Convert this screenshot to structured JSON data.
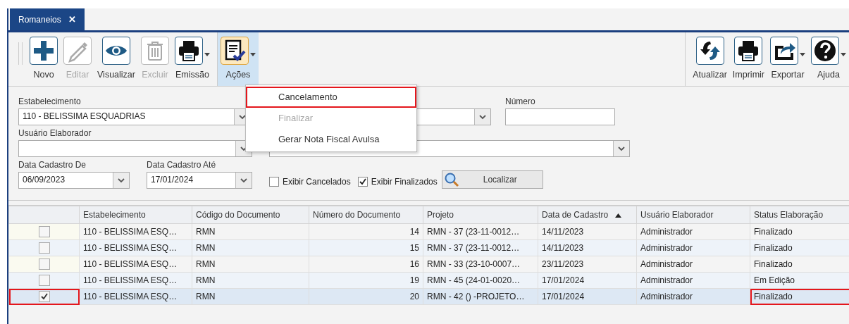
{
  "tabs": [
    {
      "label": "Romaneios",
      "selected": true,
      "close": "✕"
    }
  ],
  "toolbar": {
    "left": [
      {
        "label": "Novo",
        "disabled": false,
        "dropdown": false,
        "active": false
      },
      {
        "label": "Editar",
        "disabled": true,
        "dropdown": false,
        "active": false
      },
      {
        "label": "Visualizar",
        "disabled": false,
        "dropdown": false,
        "active": false
      },
      {
        "label": "Excluir",
        "disabled": true,
        "dropdown": false,
        "active": false
      },
      {
        "label": "Emissão",
        "disabled": false,
        "dropdown": true,
        "active": false
      },
      {
        "label": "Ações",
        "disabled": false,
        "dropdown": true,
        "active": true
      }
    ],
    "right": [
      {
        "label": "Atualizar",
        "disabled": false,
        "dropdown": false,
        "active": false
      },
      {
        "label": "Imprimir",
        "disabled": false,
        "dropdown": false,
        "active": false
      },
      {
        "label": "Exportar",
        "disabled": false,
        "dropdown": true,
        "active": false
      },
      {
        "label": "Ajuda",
        "disabled": false,
        "dropdown": true,
        "active": false
      }
    ]
  },
  "actions_menu": [
    {
      "label": "Cancelamento",
      "disabled": false,
      "marked": true
    },
    {
      "label": "Finalizar",
      "disabled": true,
      "marked": false
    },
    {
      "label": "Gerar Nota Fiscal Avulsa",
      "disabled": false,
      "marked": false
    }
  ],
  "filters": {
    "estabelecimento": {
      "label": "Estabelecimento",
      "value": "110 - BELISSIMA ESQUADRIAS"
    },
    "numero": {
      "label": "Número"
    },
    "usuario": {
      "label": "Usuário Elaborador"
    },
    "data_de": {
      "label": "Data Cadastro De",
      "value": "06/09/2023"
    },
    "data_ate": {
      "label": "Data Cadastro Até",
      "value": "17/01/2024"
    },
    "checks": [
      {
        "label": "Exibir Cancelados",
        "checked": false
      },
      {
        "label": "Exibir Finalizados",
        "checked": true
      }
    ],
    "search_button": "Localizar"
  },
  "table": {
    "columns": [
      {
        "label": "Estabelecimento",
        "sorted": false
      },
      {
        "label": "Código do Documento",
        "sorted": false
      },
      {
        "label": "Número do Documento",
        "sorted": false
      },
      {
        "label": "Projeto",
        "sorted": false
      },
      {
        "label": "Data de Cadastro",
        "sorted": true
      },
      {
        "label": "Usuário Elaborador",
        "sorted": false
      },
      {
        "label": "Status Elaboração",
        "sorted": false
      }
    ],
    "rows": [
      {
        "checked": false,
        "selected": false,
        "marked": false,
        "cells": [
          "110 - BELISSIMA ESQ…",
          "RMN",
          "14",
          "RMN - 37 (23-11-0012…",
          "14/11/2023",
          "Administrador",
          "Finalizado"
        ]
      },
      {
        "checked": false,
        "selected": false,
        "marked": false,
        "cells": [
          "110 - BELISSIMA ESQ…",
          "RMN",
          "15",
          "RMN - 37 (23-11-0012…",
          "14/11/2023",
          "Administrador",
          "Finalizado"
        ]
      },
      {
        "checked": false,
        "selected": false,
        "marked": false,
        "cells": [
          "110 - BELISSIMA ESQ…",
          "RMN",
          "16",
          "RMN - 33 (23-10-0007…",
          "23/11/2023",
          "Administrador",
          "Finalizado"
        ]
      },
      {
        "checked": false,
        "selected": false,
        "marked": false,
        "cells": [
          "110 - BELISSIMA ESQ…",
          "RMN",
          "19",
          "RMN - 45 (24-01-0020…",
          "17/01/2024",
          "Administrador",
          "Em Edição"
        ]
      },
      {
        "checked": true,
        "selected": true,
        "marked": true,
        "cells": [
          "110 - BELISSIMA ESQ…",
          "RMN",
          "20",
          "RMN - 42 () -PROJETO…",
          "17/01/2024",
          "Administrador",
          "Finalizado"
        ]
      }
    ]
  }
}
